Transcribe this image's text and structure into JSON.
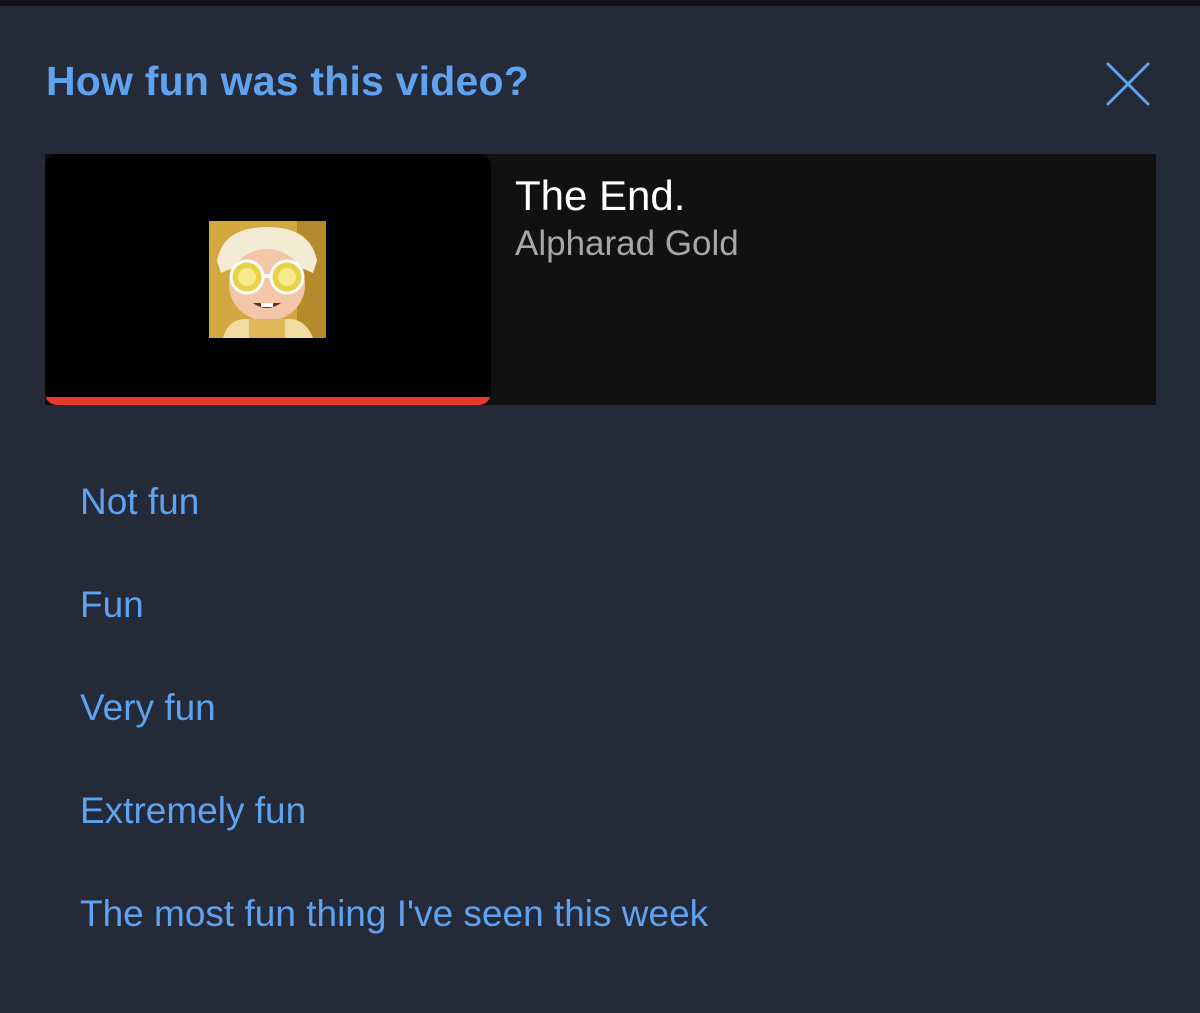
{
  "dialog": {
    "title": "How fun was this video?",
    "close_icon": "close-icon"
  },
  "video": {
    "title": "The End.",
    "channel": "Alpharad Gold",
    "watch_progress_percent": 100,
    "progress_color": "#e83a2c"
  },
  "options": [
    {
      "label": "Not fun"
    },
    {
      "label": "Fun"
    },
    {
      "label": "Very fun"
    },
    {
      "label": "Extremely fun"
    },
    {
      "label": "The most fun thing I've seen this week"
    }
  ],
  "colors": {
    "accent": "#5ea2f0",
    "background": "#252a39",
    "card": "#111111"
  }
}
